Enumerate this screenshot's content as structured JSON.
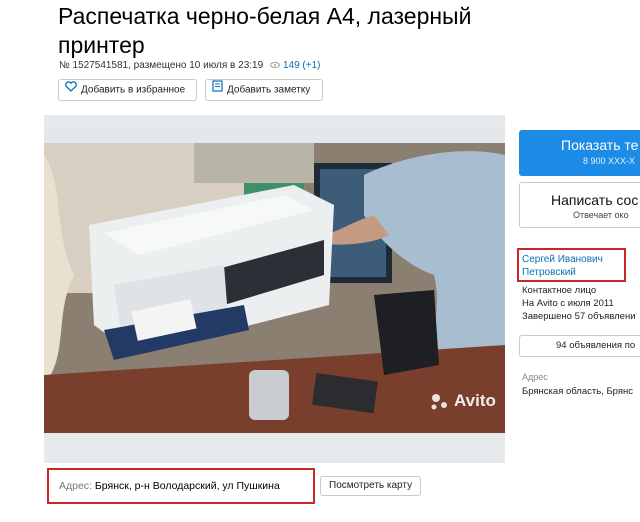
{
  "listing": {
    "title": "Распечатка черно-белая А4, лазерный принтер",
    "meta_text": "№ 1527541581, размещено 10 июля в 23:19",
    "views": "149 (+1)"
  },
  "actions": {
    "favorite_label": "Добавить в избранное",
    "note_label": "Добавить заметку"
  },
  "photo": {
    "watermark": "Avito"
  },
  "address": {
    "label": "Адрес:",
    "value": "Брянск, р-н Володарский, ул Пушкина",
    "map_button": "Посмотреть карту"
  },
  "sidebar": {
    "phone_button": "Показать те",
    "phone_sub": "8 900 XXX-X",
    "write_button": "Написать сос",
    "write_sub": "Отвечает око",
    "seller_name_line1": "Сергей Иванович",
    "seller_name_line2": "Петровский",
    "contact_role": "Контактное лицо",
    "since": "На Avito с июля 2011",
    "completed": "Завершено 57 объявлени",
    "ads_button": "94 объявления по",
    "address_label": "Адрес",
    "address_value": "Брянская область, Брянс"
  },
  "colors": {
    "accent": "#1c8ce6",
    "link": "#0a6fb3",
    "highlight_border": "#c62828"
  }
}
